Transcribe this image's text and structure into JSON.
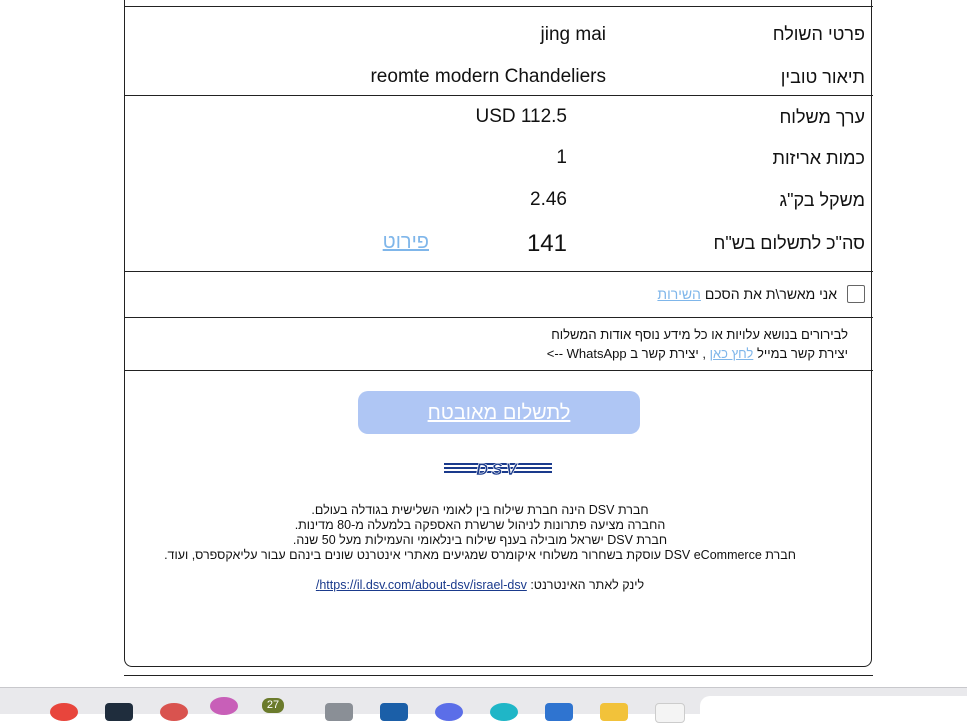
{
  "shipment": {
    "sender_label": "פרטי השולח",
    "sender_value": "jing mai",
    "goods_label": "תיאור טובין",
    "goods_value": "reomte modern Chandeliers"
  },
  "values": {
    "shipment_value_label": "ערך משלוח",
    "shipment_value": "USD 112.5",
    "packages_label": "כמות אריזות",
    "packages_value": "1",
    "weight_label": "משקל בק\"ג",
    "weight_value": "2.46",
    "total_label": "סה\"כ לתשלום בש\"ח",
    "total_value": "141",
    "details_link": "פירוט"
  },
  "terms": {
    "prefix": "אני מאשר\\ת את הסכם",
    "link": "השירות"
  },
  "contact": {
    "line1": "לבירורים בנושא עלויות או כל מידע נוסף אודות המשלוח",
    "line2_prefix": "יצירת קשר במייל",
    "line2_link": "לחץ כאן",
    "line2_suffix": ", יצירת קשר ב WhatsApp -->"
  },
  "payment": {
    "button_label": "לתשלום מאובטח"
  },
  "brand": {
    "logo_text": "DSV",
    "logo_color": "#1a3a8c"
  },
  "about": {
    "line1": "חברת DSV הינה חברת שילוח בין לאומי השלישית בגודלה בעולם.",
    "line2": "החברה מציעה פתרונות לניהול שרשרת האספקה בלמעלה מ-80 מדינות.",
    "line3": "חברת DSV ישראל מובילה בענף שילוח בינלאומי והעמילות מעל 50 שנה.",
    "line4": "חברת DSV eCommerce עוסקת בשחרור משלוחי איקומרס שמגיעים מאתרי אינטרנט שונים בינהם עבור עליאקספרס, ועוד.",
    "website_label": "לינק לאתר האינטרנט:",
    "website_url": "https://il.dsv.com/about-dsv/israel-dsv/"
  },
  "taskbar": {
    "badge_count": "27"
  }
}
